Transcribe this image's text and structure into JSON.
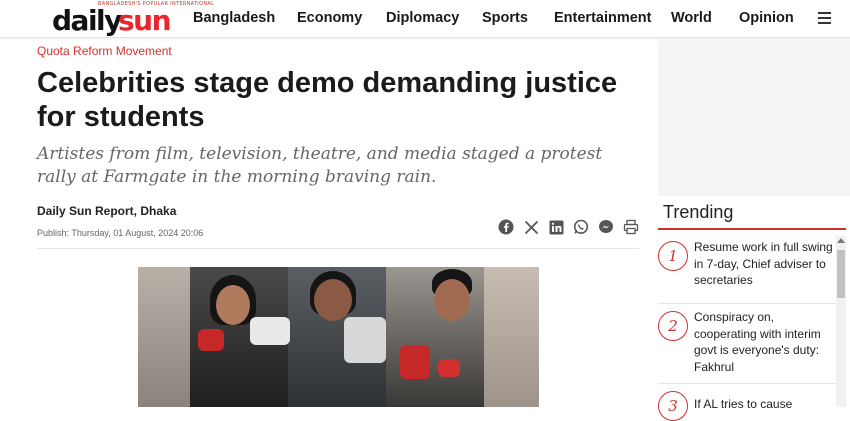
{
  "brand": {
    "logo_word1": "daily",
    "logo_word2": "sun",
    "tagline": "BANGLADESH'S POPULAR INTERNATIONAL",
    "accent_color": "#e8262c"
  },
  "nav": {
    "items": [
      "Bangladesh",
      "Economy",
      "Diplomacy",
      "Sports",
      "Entertainment",
      "World",
      "Opinion"
    ],
    "menu_icon": "hamburger-icon"
  },
  "article": {
    "category": "Quota Reform Movement",
    "headline": "Celebrities stage demo demanding justice for students",
    "subhead": "Artistes from film, television, theatre, and media staged a protest rally at Farmgate in the morning braving rain.",
    "byline": "Daily Sun Report, Dhaka",
    "published": "Publish: Thursday, 01 August, 2024 20:06",
    "share_icons": [
      "facebook-icon",
      "x-icon",
      "linkedin-icon",
      "whatsapp-icon",
      "messenger-icon",
      "print-icon"
    ]
  },
  "sidebar": {
    "trending_title": "Trending",
    "items": [
      {
        "num": "1",
        "text": "Resume work in full swing in 7-day, Chief adviser to secretaries"
      },
      {
        "num": "2",
        "text": "Conspiracy on, cooperating with interim govt is everyone's duty: Fakhrul"
      },
      {
        "num": "3",
        "text": "If AL tries to cause"
      }
    ]
  }
}
